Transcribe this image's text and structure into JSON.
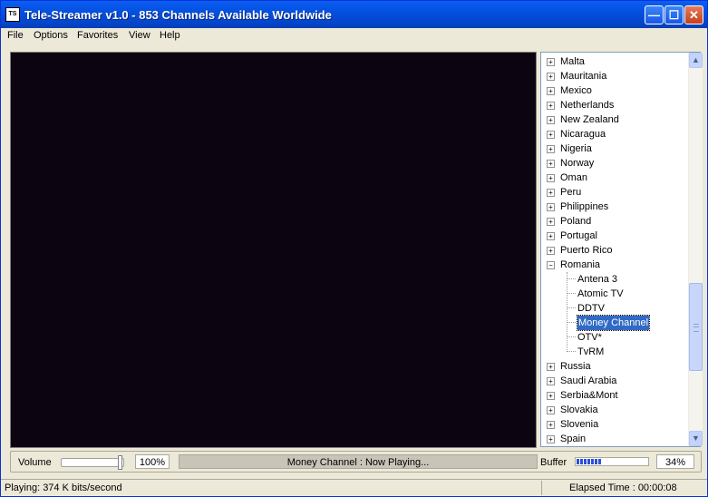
{
  "window": {
    "title": "Tele-Streamer v1.0 - 853 Channels Available Worldwide",
    "app_icon": "TS",
    "minimize": "—",
    "maximize": "☐",
    "close": "✕"
  },
  "menu": [
    "File",
    "Options",
    "Favorites",
    "View",
    "Help"
  ],
  "tree": {
    "countries_before": [
      "Malta",
      "Mauritania",
      "Mexico",
      "Netherlands",
      "New Zealand",
      "Nicaragua",
      "Nigeria",
      "Norway",
      "Oman",
      "Peru",
      "Philippines",
      "Poland",
      "Portugal",
      "Puerto Rico"
    ],
    "expanded_country": "Romania",
    "channels": [
      "Antena 3",
      "Atomic TV",
      "DDTV",
      "Money Channel",
      "OTV*",
      "TvRM"
    ],
    "selected_channel": "Money Channel",
    "countries_after": [
      "Russia",
      "Saudi Arabia",
      "Serbia&Mont",
      "Slovakia",
      "Slovenia",
      "Spain"
    ],
    "expand_glyph": "+",
    "collapse_glyph": "−"
  },
  "scrollbar": {
    "up_arrow": "▲",
    "down_arrow": "▼"
  },
  "controls": {
    "volume_label": "Volume",
    "volume_value": "100%",
    "volume_level": 1.0,
    "now_playing": "Money Channel : Now Playing...",
    "buffer_label": "Buffer",
    "buffer_value": "34%",
    "buffer_level": 0.34
  },
  "status": {
    "left": "Playing: 374 K bits/second",
    "right": "Elapsed Time : 00:00:08"
  },
  "colors": {
    "titlebar": "#0550e0",
    "video_bg": "#0c0410",
    "selection": "#316ac5"
  }
}
